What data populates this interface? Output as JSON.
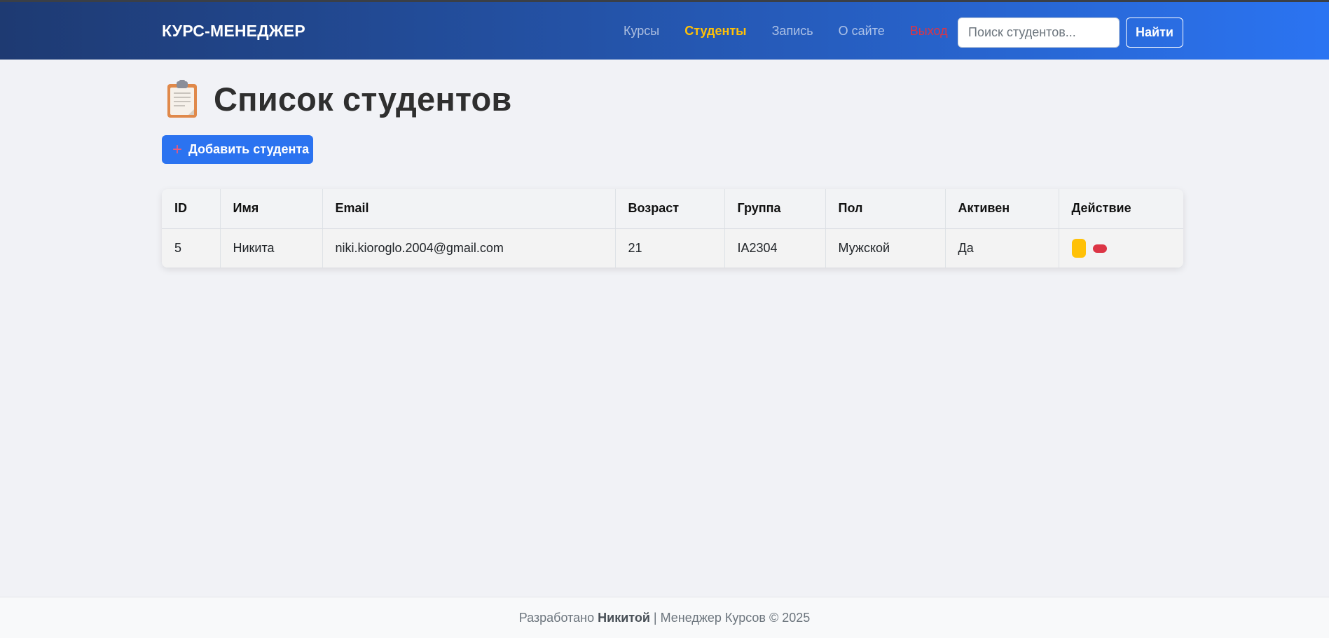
{
  "navbar": {
    "brand": "КУРС-МЕНЕДЖЕР",
    "links": [
      {
        "label": "Курсы",
        "state": "default"
      },
      {
        "label": "Студенты",
        "state": "active"
      },
      {
        "label": "Запись",
        "state": "default"
      },
      {
        "label": "О сайте",
        "state": "default"
      },
      {
        "label": "Выход",
        "state": "danger"
      }
    ],
    "search": {
      "placeholder": "Поиск студентов...",
      "value": ""
    },
    "search_button": "Найти"
  },
  "main": {
    "title_icon": "clipboard-icon",
    "title": "Список студентов",
    "add_button": {
      "icon": "plus-icon",
      "label": "Добавить студента"
    }
  },
  "table": {
    "columns": [
      "ID",
      "Имя",
      "Email",
      "Возраст",
      "Группа",
      "Пол",
      "Активен",
      "Действие"
    ],
    "rows": [
      {
        "id": "5",
        "name": "Никита",
        "email": "niki.kioroglo.2004@gmail.com",
        "age": "21",
        "group": "IA2304",
        "gender": "Мужской",
        "active": "Да",
        "actions": [
          "edit-button",
          "delete-button"
        ]
      }
    ]
  },
  "footer": {
    "prefix": "Разработано",
    "author": "Никитой",
    "suffix": "| Менеджер Курсов © 2025"
  },
  "colors": {
    "nav_gradient_start": "#1e3a72",
    "nav_gradient_end": "#2b74f2",
    "active_link": "#ffc107",
    "logout_link": "#dc3545",
    "primary_button": "#2b73f0",
    "edit_button": "#ffc107",
    "delete_button": "#dc3545",
    "background": "#f1f2f6"
  }
}
